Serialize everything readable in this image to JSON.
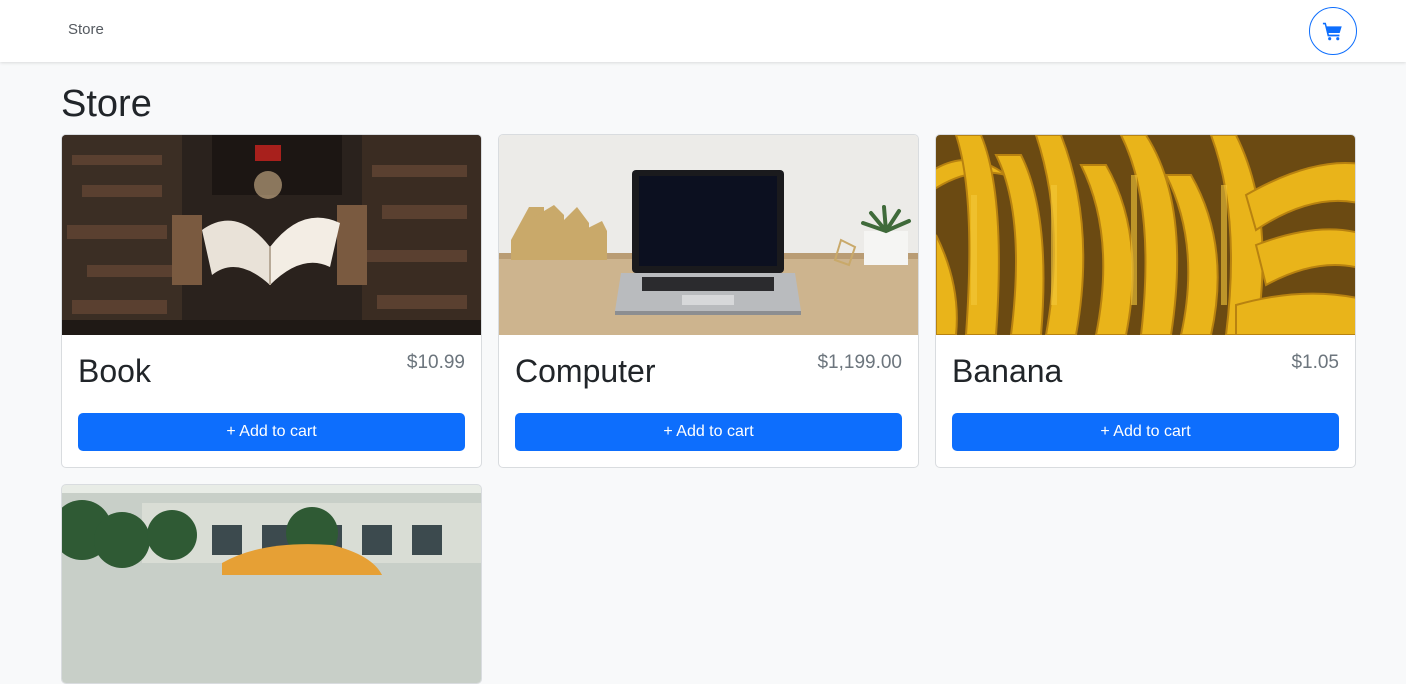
{
  "navbar": {
    "store_link": "Store",
    "cart_icon": "shopping-cart-icon"
  },
  "page": {
    "title": "Store"
  },
  "products": [
    {
      "name": "Book",
      "price": "$10.99",
      "add_label": "+ Add to cart",
      "image": "flying-book-library-photo"
    },
    {
      "name": "Computer",
      "price": "$1,199.00",
      "add_label": "+ Add to cart",
      "image": "laptop-on-desk-photo"
    },
    {
      "name": "Banana",
      "price": "$1.05",
      "add_label": "+ Add to cart",
      "image": "bananas-photo"
    },
    {
      "image": "yellow-car-street-photo"
    }
  ],
  "colors": {
    "primary": "#0d6efd",
    "background": "#f8f9fa",
    "price_text": "#6c757d"
  }
}
